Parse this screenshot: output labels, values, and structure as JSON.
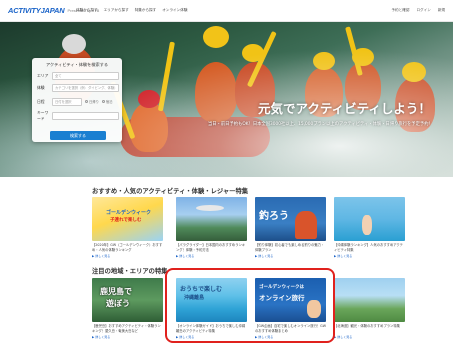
{
  "nav": {
    "logo": "ACTIVITYJAPAN",
    "logo_sub": "Presented by JTB",
    "links": [
      "体験から探す",
      "エリアから探す",
      "特集から探す",
      "オンライン体験"
    ],
    "right": [
      "予約と確認",
      "ログイン",
      "新規"
    ]
  },
  "hero": {
    "title": "元気でアクティビティしよう！",
    "desc": "当日・前日予約もOK！日本全国3000社以上、15,000プラン以上のアクティビティ・体験・日帰り旅行を予定予約！"
  },
  "search": {
    "title": "アクティビティ・体験を検索する",
    "area_label": "エリア",
    "area_placeholder": "全て",
    "genre_label": "体験",
    "genre_placeholder": "カテゴリを選択（例：ダイビング、体験）",
    "date_label": "日程",
    "date_placeholder": "日付を選択",
    "radio_options": [
      "日帰り",
      "宿泊"
    ],
    "keyword_label": "キーワード",
    "keyword_placeholder": "",
    "button": "検索する"
  },
  "section1": {
    "title": "おすすめ・人気のアクティビティ・体験・レジャー特集",
    "cards": [
      {
        "overlay": "ゴールデンウィーク",
        "overlay2": "子連れで楽しむ",
        "text": "【2020年】GW（ゴールデンウィーク）おすすめ・人気の体験ランキング",
        "more": "▶ 詳しく見る"
      },
      {
        "overlay": "",
        "overlay2": "",
        "text": "【パラグライダー】日本国内のおすすめランキング！体験・予約方法",
        "more": "▶ 詳しく見る"
      },
      {
        "overlay": "釣ろう",
        "overlay2": "",
        "text": "【釣り体験】初心者でも楽しめる釣りの魅力・体験プラン",
        "more": "▶ 詳しく見る"
      },
      {
        "overlay": "",
        "overlay2": "",
        "text": "【沖縄体験ランキング】人気のおすすめアクティビティ特集",
        "more": "▶ 詳しく見る"
      }
    ]
  },
  "section2": {
    "title": "注目の地域・エリアの特集",
    "cards": [
      {
        "overlay": "鹿児島で",
        "overlay2": "遊ぼう",
        "text": "【鹿児島】おすすめアクティビティ・体験ランキング！屋久島・奄美大島など",
        "more": "▶ 詳しく見る"
      },
      {
        "overlay": "おうちで楽しむ",
        "overlay2": "沖縄離島",
        "text": "【オンライン体験ガイド】おうちで楽しむ沖縄離島のアクティビティ特集",
        "more": "▶ 詳しく見る"
      },
      {
        "overlay": "ゴールデンウィークは",
        "overlay2": "オンライン旅行",
        "text": "【GW企画】自宅で楽しむオンライン旅行！GWのおすすめ体験まとめ",
        "more": "▶ 詳しく見る"
      },
      {
        "overlay": "",
        "overlay2": "",
        "text": "【北海道】観光・体験のおすすめプラン特集",
        "more": "▶ 詳しく見る"
      }
    ]
  },
  "colors": {
    "brand": "#1a63c8",
    "button": "#1a7fd1",
    "highlight": "#e0211d"
  }
}
